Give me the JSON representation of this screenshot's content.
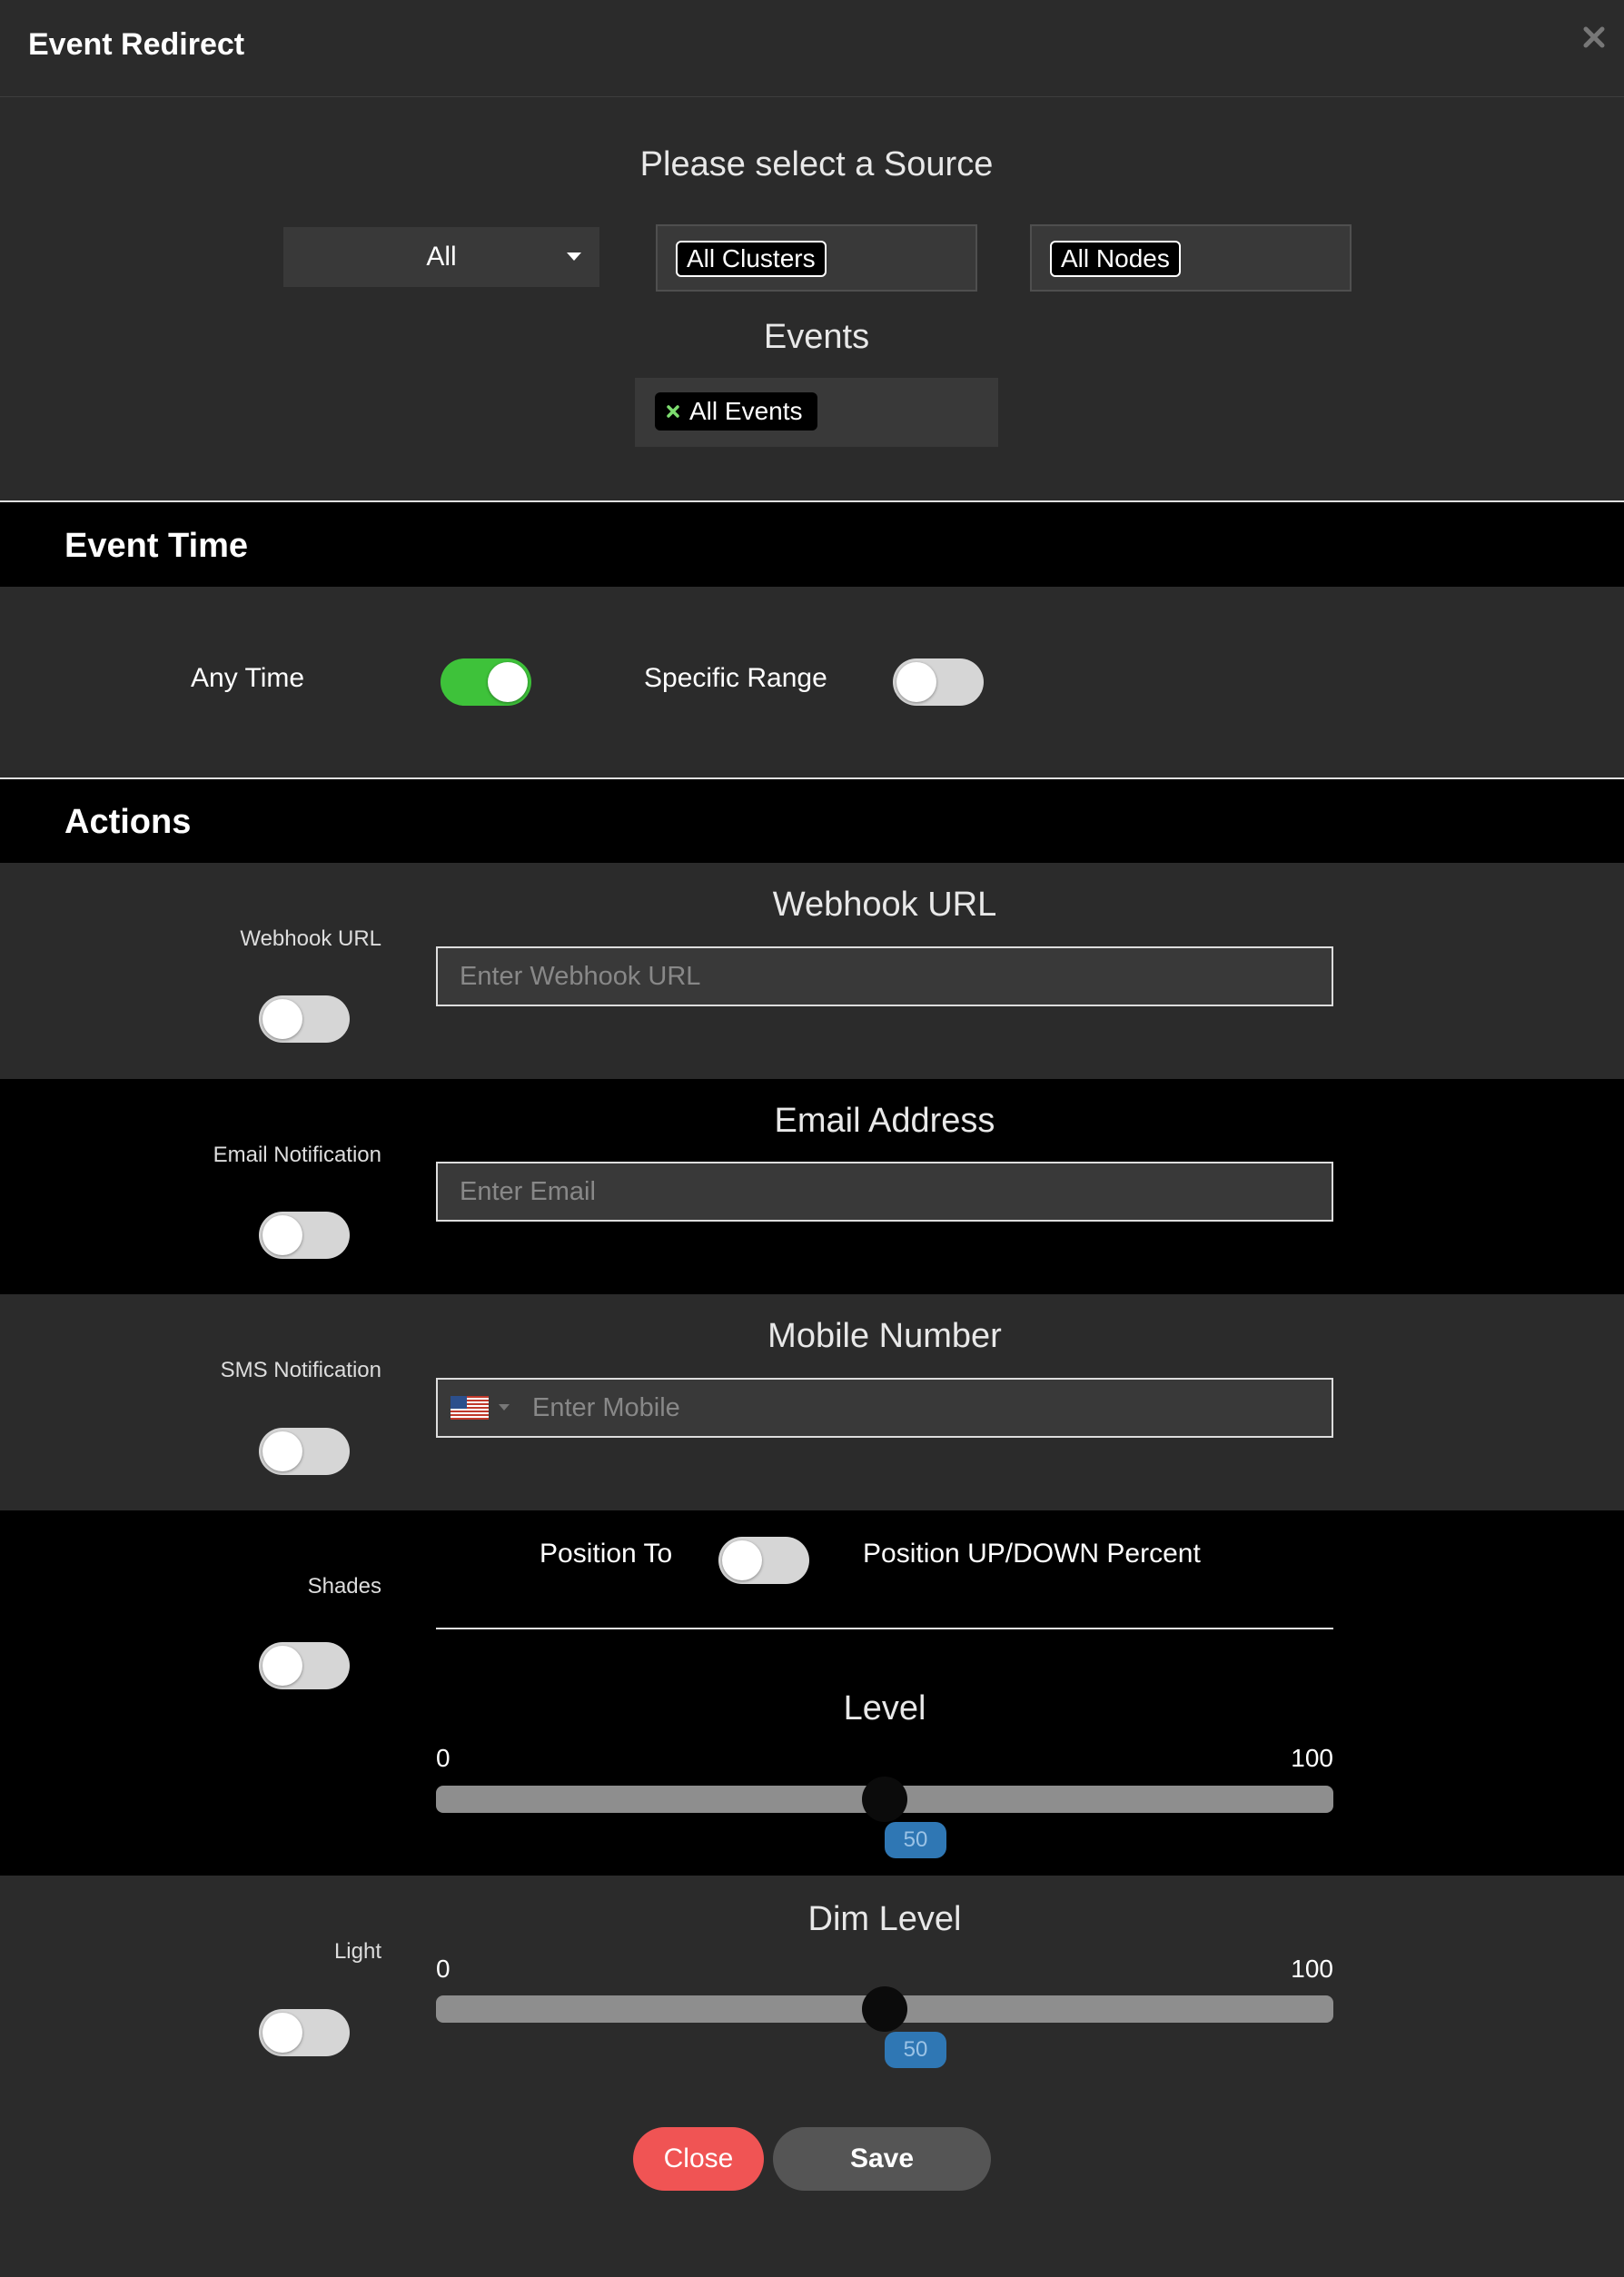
{
  "modal": {
    "title": "Event Redirect"
  },
  "source": {
    "heading": "Please select a Source",
    "select_value": "All",
    "clusters_tag": "All Clusters",
    "nodes_tag": "All Nodes",
    "events_heading": "Events",
    "events_tag": "All Events"
  },
  "event_time": {
    "heading": "Event Time",
    "any_time_label": "Any Time",
    "any_time_on": true,
    "specific_range_label": "Specific Range",
    "specific_range_on": false
  },
  "actions": {
    "heading": "Actions",
    "webhook": {
      "toggle_label": "Webhook URL",
      "title": "Webhook URL",
      "placeholder": "Enter Webhook URL",
      "on": false
    },
    "email": {
      "toggle_label": "Email Notification",
      "title": "Email Address",
      "placeholder": "Enter Email",
      "on": false
    },
    "sms": {
      "toggle_label": "SMS Notification",
      "title": "Mobile Number",
      "placeholder": "Enter Mobile",
      "country_icon": "us-flag-icon",
      "on": false
    },
    "shades": {
      "toggle_label": "Shades",
      "position_to_label": "Position To",
      "position_percent_label": "Position UP/DOWN Percent",
      "position_toggle_on": false,
      "level_title": "Level",
      "min": "0",
      "max": "100",
      "value": "50",
      "on": false
    },
    "light": {
      "toggle_label": "Light",
      "dim_title": "Dim Level",
      "min": "0",
      "max": "100",
      "value": "50",
      "on": false
    }
  },
  "buttons": {
    "close": "Close",
    "save": "Save"
  },
  "colors": {
    "toggle_on": "#3ec23a",
    "close_button": "#f05454",
    "slider_bubble": "#2f77b4"
  }
}
